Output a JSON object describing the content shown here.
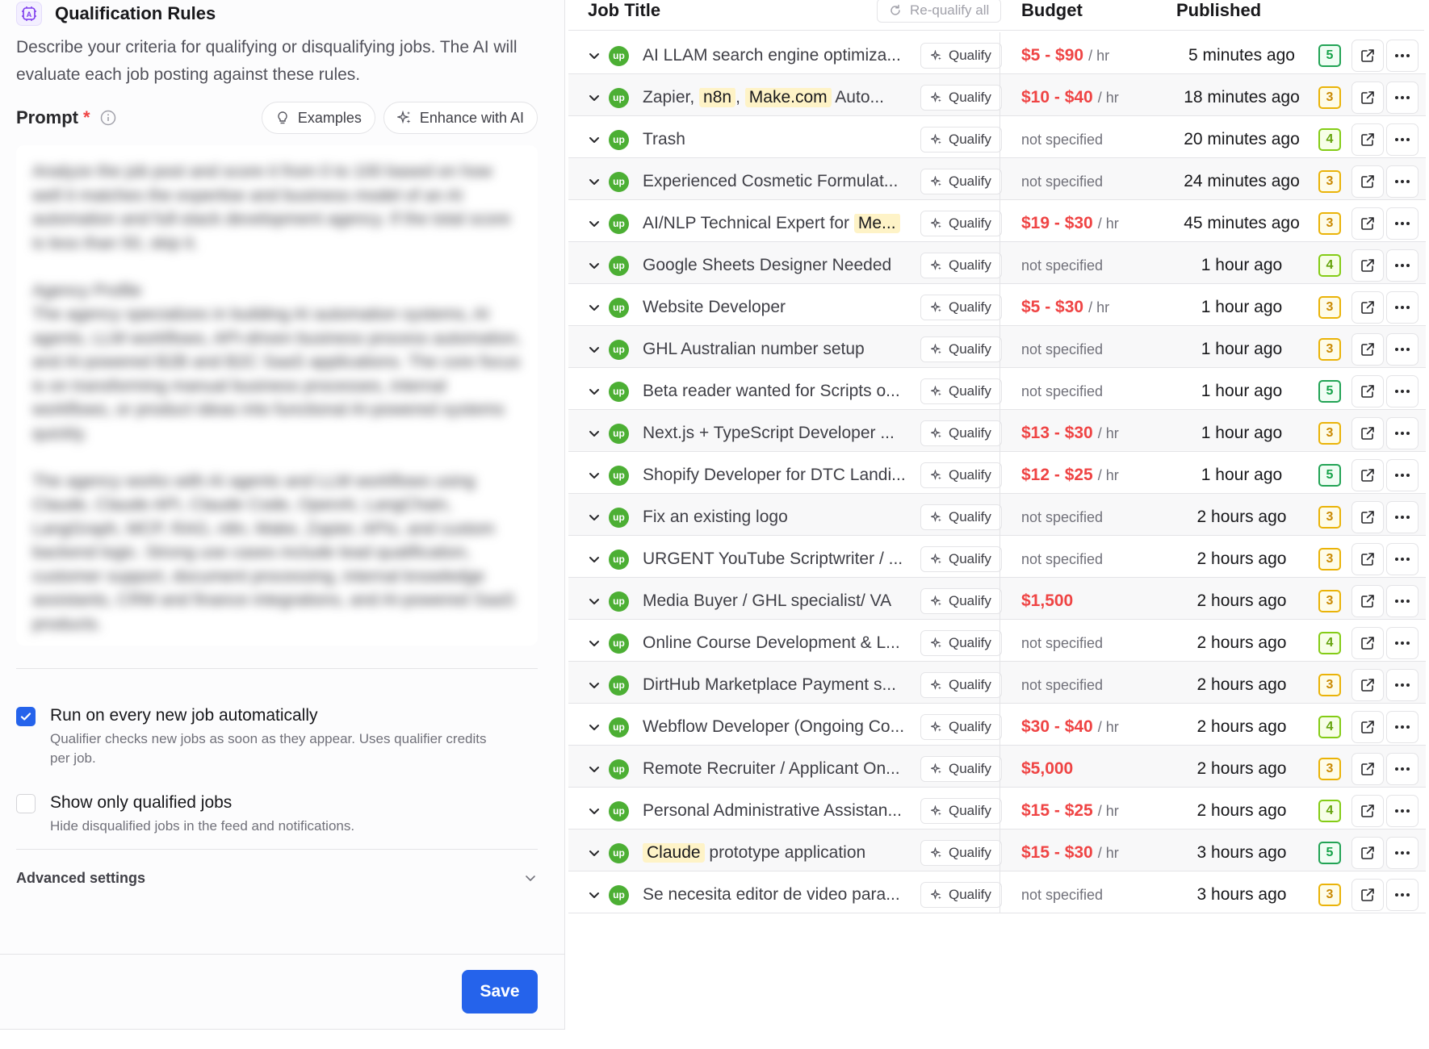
{
  "panel": {
    "title": "Qualification Rules",
    "description": "Describe your criteria for qualifying or disqualifying jobs. The AI will evaluate each job posting against these rules.",
    "prompt_label": "Prompt",
    "required_mark": "*",
    "examples_label": "Examples",
    "enhance_label": "Enhance with AI",
    "prompt_text": "Analyze the job post and score it from 0 to 100 based on how well it matches the expertise and business model of an AI automation and full-stack development agency. If the total score is less than 50, skip it.\n\nAgency Profile\nThe agency specializes in building AI automation systems, AI agents, LLM workflows, API-driven business process automation, and AI-powered B2B and B2C SaaS applications. The core focus is on transforming manual business processes, internal workflows, or product ideas into functional AI-powered systems quickly.\n\nThe agency works with AI agents and LLM workflows using Claude, Claude API, Claude Code, OpenAI, LangChain, LangGraph, MCP, RAG, n8n, Make, Zapier, APIs, and custom backend logic. Strong use cases include lead qualification, customer support, document processing, internal knowledge assistants, CRM and finance integrations, and AI-powered SaaS products.",
    "auto_run_title": "Run on every new job automatically",
    "auto_run_desc": "Qualifier checks new jobs as soon as they appear. Uses qualifier credits per job.",
    "show_qualified_title": "Show only qualified jobs",
    "show_qualified_desc": "Hide disqualified jobs in the feed and notifications.",
    "advanced_label": "Advanced settings",
    "save_label": "Save"
  },
  "table": {
    "col_job_title": "Job Title",
    "requalify_label": "Re-qualify all",
    "col_budget": "Budget",
    "col_published": "Published",
    "qualify_label": "Qualify",
    "upwork_mark": "up",
    "per_hour": "/ hr",
    "not_specified": "not specified",
    "rows": [
      {
        "title": "AI LLAM search engine optimiza...",
        "budget": "$5 - $90",
        "hourly": true,
        "published": "5 minutes ago",
        "score": "5"
      },
      {
        "title_parts": [
          {
            "t": "Zapier, "
          },
          {
            "t": "n8n",
            "hl": true
          },
          {
            "t": ", "
          },
          {
            "t": "Make.com",
            "hl": true
          },
          {
            "t": " Auto..."
          }
        ],
        "budget": "$10 - $40",
        "hourly": true,
        "published": "18 minutes ago",
        "score": "3"
      },
      {
        "title": "Trash",
        "budget": "",
        "hourly": false,
        "published": "20 minutes ago",
        "score": "4"
      },
      {
        "title": "Experienced Cosmetic Formulat...",
        "budget": "",
        "hourly": false,
        "published": "24 minutes ago",
        "score": "3"
      },
      {
        "title_parts": [
          {
            "t": "AI/NLP Technical Expert for "
          },
          {
            "t": "Me...",
            "hl": true
          }
        ],
        "budget": "$19 - $30",
        "hourly": true,
        "published": "45 minutes ago",
        "score": "3"
      },
      {
        "title": "Google Sheets Designer Needed",
        "budget": "",
        "hourly": false,
        "published": "1 hour ago",
        "score": "4"
      },
      {
        "title": "Website Developer",
        "budget": "$5 - $30",
        "hourly": true,
        "published": "1 hour ago",
        "score": "3"
      },
      {
        "title": "GHL Australian number setup",
        "budget": "",
        "hourly": false,
        "published": "1 hour ago",
        "score": "3"
      },
      {
        "title": "Beta reader wanted for Scripts o...",
        "budget": "",
        "hourly": false,
        "published": "1 hour ago",
        "score": "5"
      },
      {
        "title": "Next.js + TypeScript Developer ...",
        "budget": "$13 - $30",
        "hourly": true,
        "published": "1 hour ago",
        "score": "3"
      },
      {
        "title": "Shopify Developer for DTC Landi...",
        "budget": "$12 - $25",
        "hourly": true,
        "published": "1 hour ago",
        "score": "5"
      },
      {
        "title": "Fix an existing logo",
        "budget": "",
        "hourly": false,
        "published": "2 hours ago",
        "score": "3"
      },
      {
        "title": "URGENT YouTube Scriptwriter / ...",
        "budget": "",
        "hourly": false,
        "published": "2 hours ago",
        "score": "3"
      },
      {
        "title": "Media Buyer / GHL specialist/ VA",
        "budget": "$1,500",
        "hourly": false,
        "published": "2 hours ago",
        "score": "3"
      },
      {
        "title": "Online Course Development & L...",
        "budget": "",
        "hourly": false,
        "published": "2 hours ago",
        "score": "4"
      },
      {
        "title": "DirtHub Marketplace Payment s...",
        "budget": "",
        "hourly": false,
        "published": "2 hours ago",
        "score": "3"
      },
      {
        "title": "Webflow Developer (Ongoing Co...",
        "budget": "$30 - $40",
        "hourly": true,
        "published": "2 hours ago",
        "score": "4"
      },
      {
        "title": "Remote Recruiter / Applicant On...",
        "budget": "$5,000",
        "hourly": false,
        "published": "2 hours ago",
        "score": "3"
      },
      {
        "title": "Personal Administrative Assistan...",
        "budget": "$15 - $25",
        "hourly": true,
        "published": "2 hours ago",
        "score": "4"
      },
      {
        "title_parts": [
          {
            "t": "Claude",
            "hl": true
          },
          {
            "t": " prototype application"
          }
        ],
        "budget": "$15 - $30",
        "hourly": true,
        "published": "3 hours ago",
        "score": "5"
      },
      {
        "title": "Se necesita editor de video para...",
        "budget": "",
        "hourly": false,
        "published": "3 hours ago",
        "score": "3"
      }
    ]
  },
  "colors": {
    "accent": "#2563eb",
    "money": "#ef4444",
    "upwork": "#4caf34",
    "score_high": "#22a355",
    "score_mid": "#84cc16",
    "score_low": "#eab308"
  }
}
